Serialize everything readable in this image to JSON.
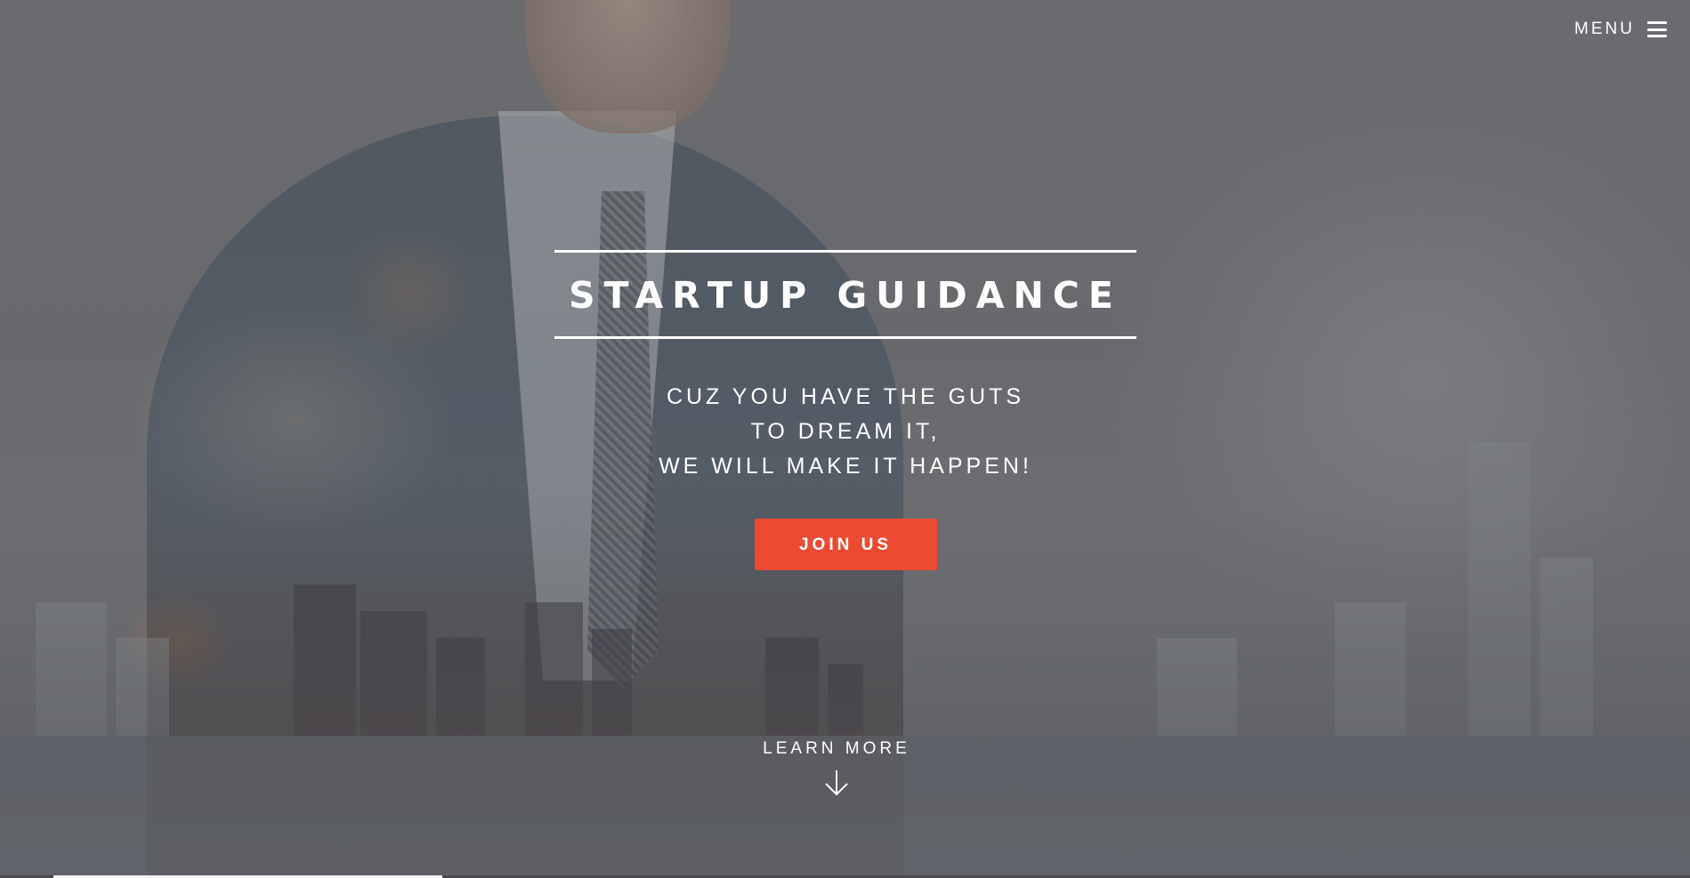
{
  "header": {
    "menu_label": "MENU",
    "menu_icon": "hamburger-icon"
  },
  "hero": {
    "title": "STARTUP GUIDANCE",
    "tagline": [
      "CUZ YOU HAVE THE GUTS",
      "TO DREAM IT,",
      "WE WILL MAKE IT HAPPEN!"
    ],
    "cta_label": "JOIN US",
    "cta_color": "#ec4a32"
  },
  "learn_more": {
    "label": "LEARN MORE",
    "icon": "arrow-down-icon"
  },
  "slider_progress": 0.23
}
